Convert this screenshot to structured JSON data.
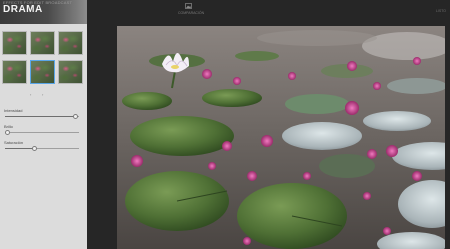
{
  "sidebar": {
    "header": {
      "meta": "EFFECTS FOR EDIT BROADCAST",
      "title": "DRAMA"
    },
    "thumbnails": [
      {
        "selected": false
      },
      {
        "selected": false
      },
      {
        "selected": false
      },
      {
        "selected": false
      },
      {
        "selected": true
      },
      {
        "selected": false
      }
    ],
    "pager": {
      "prev": "‹",
      "next": "›"
    },
    "sliders": [
      {
        "label": "Intensidad",
        "value": 0.95
      },
      {
        "label": "Brillo",
        "value": 0.03
      },
      {
        "label": "Saturación",
        "value": 0.39
      }
    ]
  },
  "toolbar": {
    "compare_label": "COMPARACIÓN",
    "compare_icon": "compare-image-icon",
    "right_label": "LISTO"
  },
  "photo": {
    "subject": "lotus pond",
    "colors": {
      "water": "#6f6c68",
      "lily_pad": "#4e6f35",
      "flower": "#d94a9c",
      "lotus": "#f2eef5"
    }
  }
}
